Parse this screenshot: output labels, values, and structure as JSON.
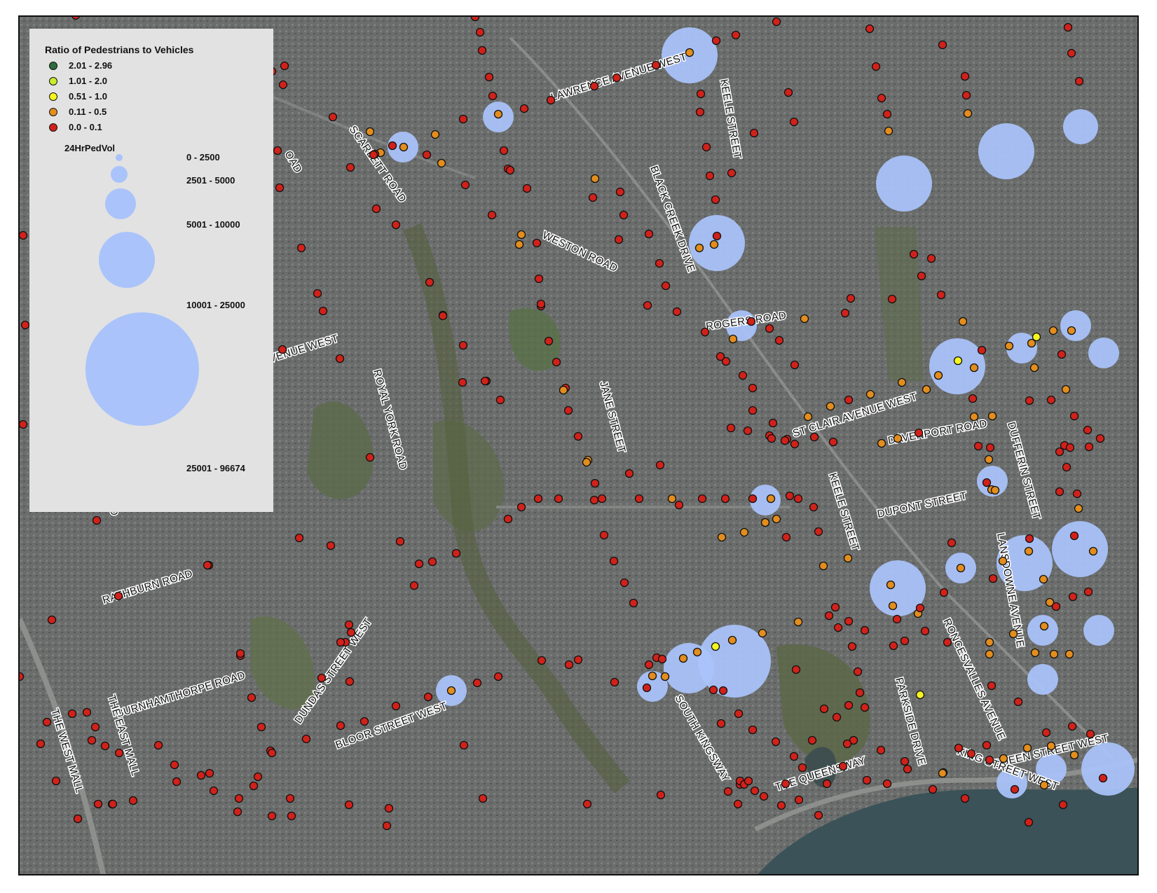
{
  "colors": {
    "ratio_2_01_2_96": "#2e6b3f",
    "ratio_1_01_2_0": "#c9ec2d",
    "ratio_0_51_1_0": "#f5f520",
    "ratio_0_11_0_5": "#e38d1e",
    "ratio_0_0_0_1": "#d0221a",
    "volume_circle": "#aac3fb",
    "legend_bg": "#e2e2e2"
  },
  "legend": {
    "title": "Ratio of Pedestrians to Vehicles",
    "ratio_classes": [
      "2.01 - 2.96",
      "1.01 - 2.0",
      "0.51 - 1.0",
      "0.11 - 0.5",
      "0.0 - 0.1"
    ],
    "volume_title": "24HrPedVol",
    "volume_classes": [
      "0 - 2500",
      "2501 - 5000",
      "5001 - 10000",
      "10001 - 25000",
      "25001 - 96674"
    ]
  },
  "street_labels": [
    "LAWRENCE AVENUE WEST",
    "KEELE STREET",
    "SCARLETT ROAD",
    "BLACK CREEK DRIVE",
    "WESTON ROAD",
    "ROGERS ROAD",
    "N AVENUE WEST",
    "ROYAL YORK ROAD",
    "JANE STREET",
    "ST CLAIR AVENUE WEST",
    "DAVENPORT ROAD",
    "DUFFERIN STREET",
    "DUPONT STREET",
    "KEELE STREET",
    "LANSDOWNE AVENUE",
    "RATHBURN ROAD",
    "DUNDAS STREET WEST",
    "BURNHAMTHORPE ROAD",
    "BLOOR STREET WEST",
    "SOUTH KINGSWAY",
    "PARKSIDE DRIVE",
    "RONCESVALLES AVENUE",
    "QUEEN STREET WEST",
    "KING STREET WEST",
    "THE QUEENSWAY",
    "THE EAST MALL",
    "THE WEST MALL",
    "OAD",
    "OAD"
  ]
}
